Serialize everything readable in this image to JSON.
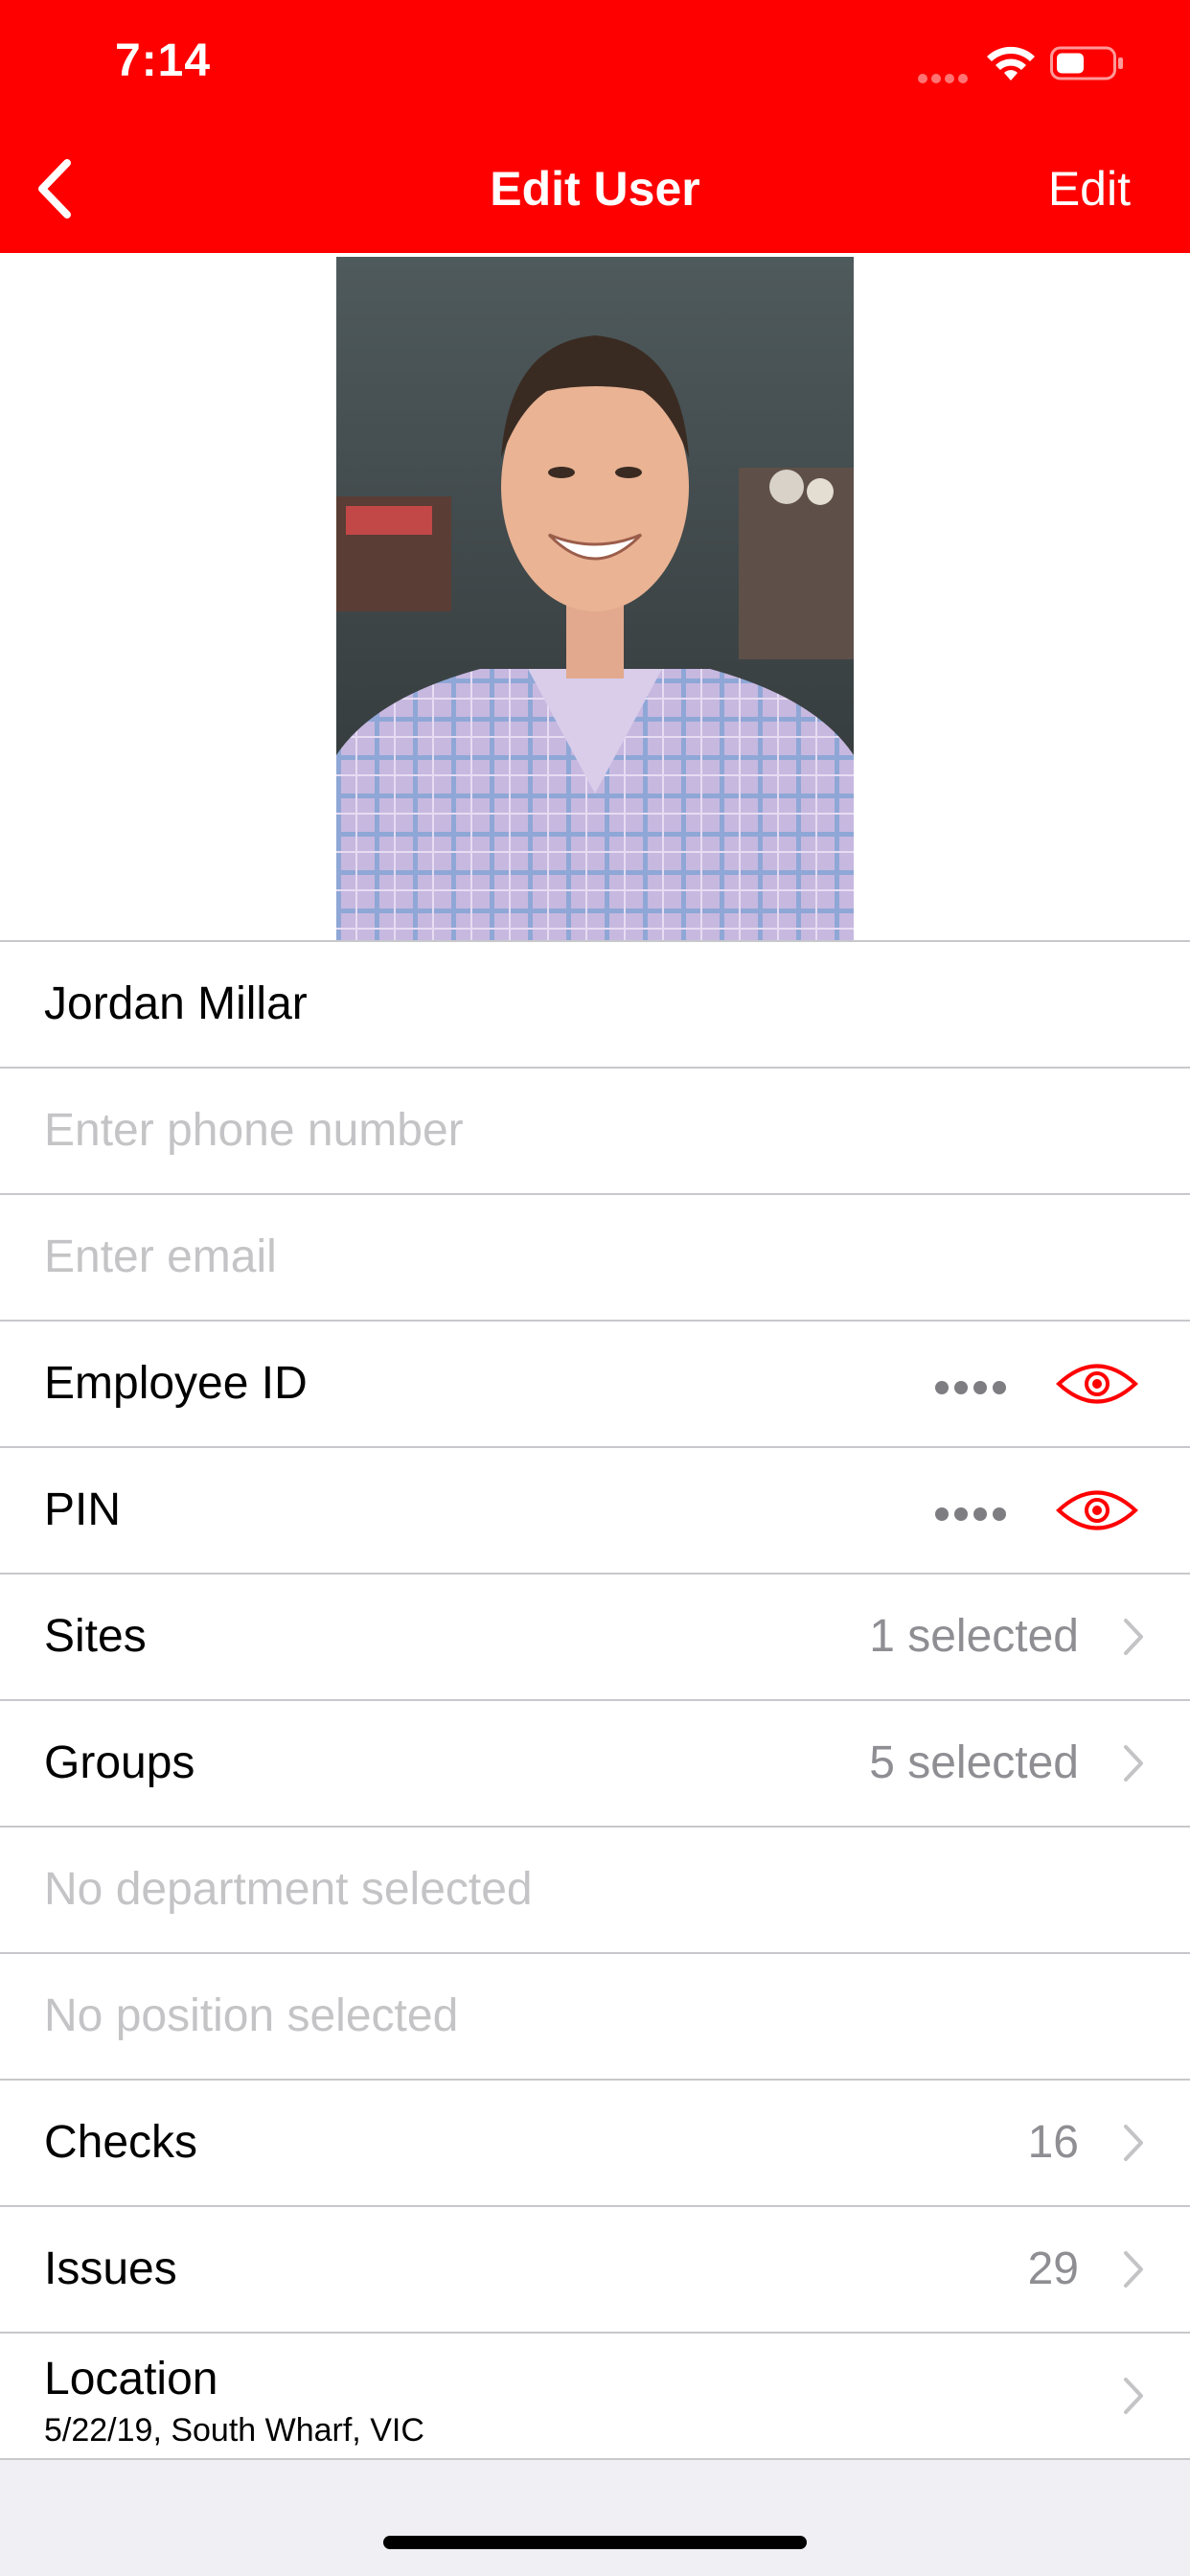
{
  "status_bar": {
    "time": "7:14",
    "signal_icon": "cellular-signal-icon",
    "wifi_icon": "wifi-icon",
    "battery_icon": "battery-icon"
  },
  "nav": {
    "back_icon": "chevron-left-icon",
    "title": "Edit User",
    "edit_label": "Edit"
  },
  "profile": {
    "photo_alt": "user-photo"
  },
  "fields": {
    "name": "Jordan Millar",
    "phone_placeholder": "Enter phone number",
    "email_placeholder": "Enter email",
    "employee_id_label": "Employee ID",
    "pin_label": "PIN",
    "sites_label": "Sites",
    "sites_value": "1 selected",
    "groups_label": "Groups",
    "groups_value": "5 selected",
    "department_placeholder": "No department selected",
    "position_placeholder": "No position selected",
    "checks_label": "Checks",
    "checks_value": "16",
    "issues_label": "Issues",
    "issues_value": "29",
    "location_label": "Location",
    "location_detail": "5/22/19, South Wharf, VIC"
  },
  "colors": {
    "brand": "#ff0000",
    "separator": "#c8c8cc",
    "placeholder": "#c4c4c6",
    "secondary_text": "#8e8e93",
    "background": "#efeff4"
  }
}
